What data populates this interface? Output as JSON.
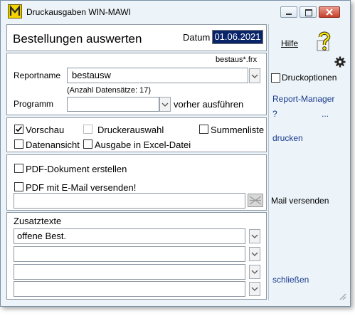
{
  "window": {
    "title": "Druckausgaben  WIN-MAWI"
  },
  "header": {
    "heading": "Bestellungen auswerten",
    "date_label": "Datum",
    "date_value": "01.06.2021"
  },
  "report": {
    "file_hint": "bestaus*.frx",
    "name_label": "Reportname",
    "name_value": "bestausw",
    "count_text": "(Anzahl Datensätze: 17)",
    "program_label": "Programm",
    "program_value": "",
    "program_suffix": "vorher ausführen"
  },
  "options": {
    "preview": "Vorschau",
    "printer_select": "Druckerauswahl",
    "sum_list": "Summenliste",
    "data_view": "Datenansicht",
    "excel_output": "Ausgabe in Excel-Datei",
    "preview_checked": true
  },
  "pdf": {
    "create": "PDF-Dokument erstellen",
    "email": "PDF mit E-Mail versenden!",
    "email_address": ""
  },
  "extra": {
    "label": "Zusatztexte",
    "lines": [
      "offene Best.",
      "",
      "",
      ""
    ]
  },
  "sidebar": {
    "help": "Hilfe",
    "print_options": "Druckoptionen",
    "report_manager": "Report-Manager",
    "question": "?",
    "ellipsis": "...",
    "print": "drucken",
    "mail_send": "Mail versenden",
    "close": "schließen"
  },
  "colors": {
    "accent": "#0a246a",
    "link": "#1a3a8c",
    "panel_bg": "#ecf4fa"
  }
}
